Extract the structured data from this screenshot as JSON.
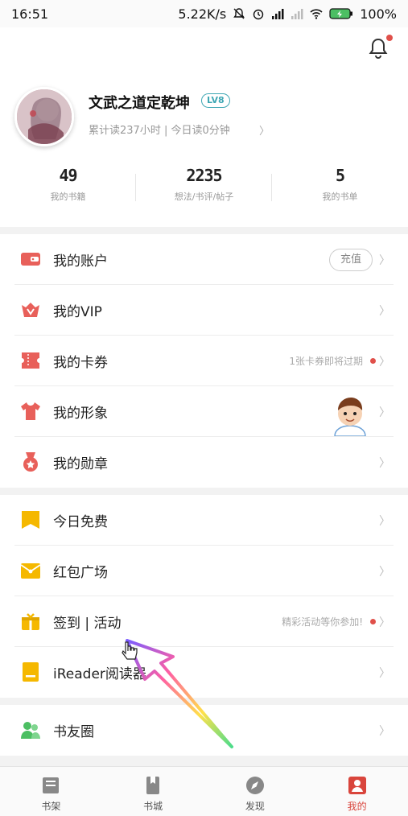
{
  "status_bar": {
    "time": "16:51",
    "network_speed": "5.22K/s",
    "battery": "100%"
  },
  "profile": {
    "username": "文武之道定乾坤",
    "level": "LV8",
    "reading_stats": "累计读237小时 | 今日读0分钟"
  },
  "stats": [
    {
      "value": "49",
      "label": "我的书籍"
    },
    {
      "value": "2235",
      "label": "想法/书评/帖子"
    },
    {
      "value": "5",
      "label": "我的书单"
    }
  ],
  "menu_group1": {
    "account": {
      "label": "我的账户",
      "button": "充值"
    },
    "vip": {
      "label": "我的VIP"
    },
    "coupons": {
      "label": "我的卡券",
      "hint": "1张卡券即将过期"
    },
    "avatar": {
      "label": "我的形象"
    },
    "medals": {
      "label": "我的勋章"
    }
  },
  "menu_group2": {
    "free_today": {
      "label": "今日免费"
    },
    "red_packet": {
      "label": "红包广场"
    },
    "checkin": {
      "label": "签到 | 活动",
      "hint": "精彩活动等你参加!"
    },
    "ireader": {
      "label": "iReader阅读器"
    }
  },
  "menu_group3": {
    "friends": {
      "label": "书友圈"
    }
  },
  "tabs": [
    {
      "label": "书架",
      "icon": "bookshelf-icon"
    },
    {
      "label": "书城",
      "icon": "bookstore-icon"
    },
    {
      "label": "发现",
      "icon": "compass-icon"
    },
    {
      "label": "我的",
      "icon": "profile-icon"
    }
  ],
  "colors": {
    "accent_red": "#e0504a",
    "accent_yellow": "#f5b800",
    "accent_green": "#4cbf63",
    "level_teal": "#3fa7b4"
  }
}
